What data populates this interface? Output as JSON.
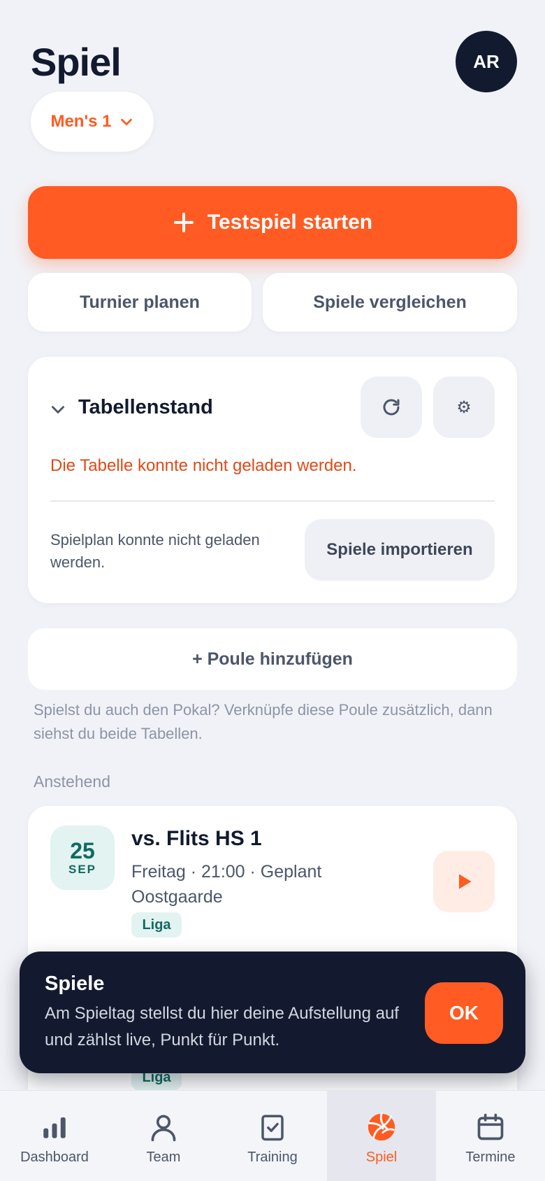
{
  "header": {
    "title": "Spiel",
    "avatar_initials": "AR",
    "team_selector": "Men's 1"
  },
  "actions": {
    "primary": "Testspiel starten",
    "tournament": "Turnier planen",
    "compare": "Spiele vergleichen"
  },
  "standings": {
    "title": "Tabellenstand",
    "error": "Die Tabelle konnte nicht geladen werden.",
    "schedule_message": "Spielplan konnte nicht geladen werden.",
    "import_label": "Spiele importieren"
  },
  "pool": {
    "add_label": "+ Poule hinzufügen",
    "hint": "Spielst du auch den Pokal? Verknüpfe diese Poule zusätzlich, dann siehst du beide Tabellen."
  },
  "upcoming": {
    "section_label": "Anstehend",
    "match": {
      "day": "25",
      "month": "SEP",
      "title": "vs. Flits HS 1",
      "meta": "Freitag · 21:00 · Geplant",
      "venue": "Oostgaarde",
      "tag": "Liga"
    },
    "next_tag": "Liga"
  },
  "toast": {
    "title": "Spiele",
    "body": "Am Spieltag stellst du hier deine Aufstellung auf und zählst live, Punkt für Punkt.",
    "ok_label": "OK"
  },
  "nav": {
    "items": [
      {
        "label": "Dashboard",
        "icon": "bar-chart-icon"
      },
      {
        "label": "Team",
        "icon": "person-icon"
      },
      {
        "label": "Training",
        "icon": "clipboard-check-icon"
      },
      {
        "label": "Spiel",
        "icon": "volleyball-icon",
        "active": true
      },
      {
        "label": "Termine",
        "icon": "calendar-icon"
      }
    ]
  },
  "colors": {
    "accent": "#ff5b22",
    "dark": "#121a2f",
    "teal": "#0f6b62",
    "error": "#e04a17"
  }
}
